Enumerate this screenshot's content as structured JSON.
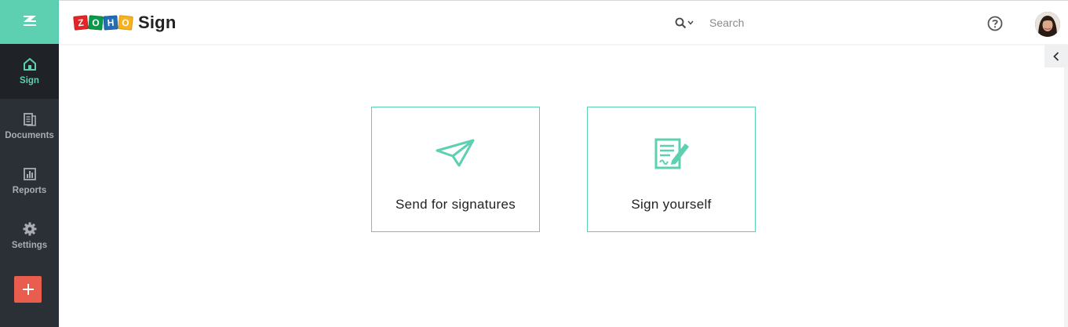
{
  "header": {
    "logo_letters": [
      "Z",
      "O",
      "H",
      "O"
    ],
    "logo_colors": [
      "#e42527",
      "#089949",
      "#226db4",
      "#f9b21d"
    ],
    "product_name": "Sign",
    "search_placeholder": "Search"
  },
  "sidebar": {
    "brand_color": "#5dd0b1",
    "items": [
      {
        "label": "Sign",
        "icon": "home-icon",
        "active": true
      },
      {
        "label": "Documents",
        "icon": "documents-icon",
        "active": false
      },
      {
        "label": "Reports",
        "icon": "reports-icon",
        "active": false
      },
      {
        "label": "Settings",
        "icon": "gear-icon",
        "active": false
      }
    ],
    "add_button_color": "#e95d4f"
  },
  "main": {
    "cards": [
      {
        "label": "Send for signatures",
        "icon": "paper-plane-icon"
      },
      {
        "label": "Sign yourself",
        "icon": "sign-document-icon"
      }
    ]
  },
  "colors": {
    "accent": "#5dd0b1",
    "sidebar_bg": "#2b2f36"
  }
}
